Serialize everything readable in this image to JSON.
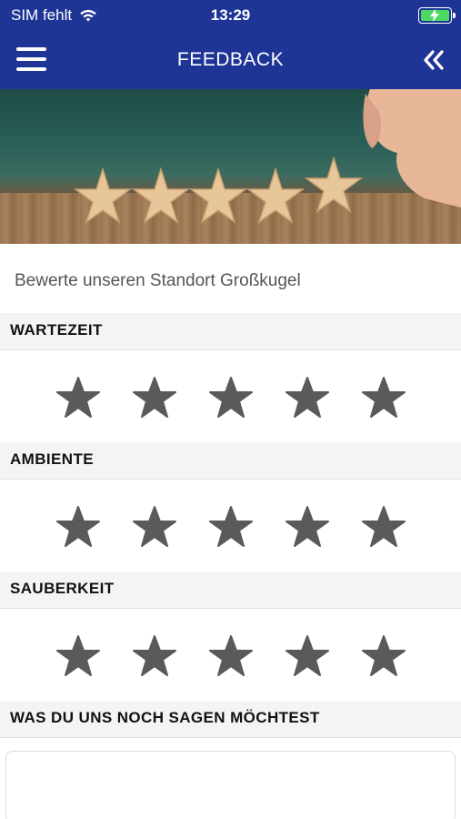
{
  "status": {
    "carrier": "SIM fehlt",
    "time": "13:29",
    "battery_color": "#4cd964"
  },
  "header": {
    "title": "FEEDBACK",
    "menu_icon": "hamburger-menu-icon",
    "back_icon": "double-chevron-left-icon",
    "background": "#1f3596"
  },
  "intro": "Bewerte unseren Standort Großkugel",
  "ratings": [
    {
      "label": "WARTEZEIT",
      "max_stars": 5,
      "selected": 0
    },
    {
      "label": "AMBIENTE",
      "max_stars": 5,
      "selected": 0
    },
    {
      "label": "SAUBERKEIT",
      "max_stars": 5,
      "selected": 0
    }
  ],
  "comment": {
    "label": "WAS DU UNS NOCH SAGEN MÖCHTEST",
    "value": "",
    "placeholder": ""
  },
  "star_color": "#5a5a5a"
}
